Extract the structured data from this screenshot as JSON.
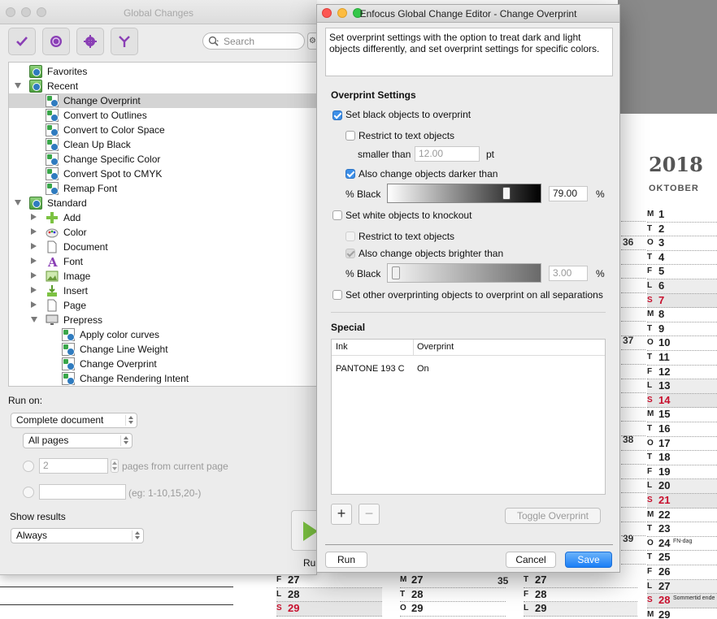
{
  "calendar": {
    "year": "2018",
    "month": "OKTOBER",
    "days": [
      {
        "d": "M",
        "n": "1"
      },
      {
        "d": "T",
        "n": "2"
      },
      {
        "d": "O",
        "n": "3"
      },
      {
        "d": "T",
        "n": "4"
      },
      {
        "d": "F",
        "n": "5"
      },
      {
        "d": "L",
        "n": "6"
      },
      {
        "d": "S",
        "n": "7"
      },
      {
        "d": "M",
        "n": "8"
      },
      {
        "d": "T",
        "n": "9"
      },
      {
        "d": "O",
        "n": "10"
      },
      {
        "d": "T",
        "n": "11"
      },
      {
        "d": "F",
        "n": "12"
      },
      {
        "d": "L",
        "n": "13"
      },
      {
        "d": "S",
        "n": "14"
      },
      {
        "d": "M",
        "n": "15"
      },
      {
        "d": "T",
        "n": "16"
      },
      {
        "d": "O",
        "n": "17"
      },
      {
        "d": "T",
        "n": "18"
      },
      {
        "d": "F",
        "n": "19"
      },
      {
        "d": "L",
        "n": "20"
      },
      {
        "d": "S",
        "n": "21"
      },
      {
        "d": "M",
        "n": "22"
      },
      {
        "d": "T",
        "n": "23"
      },
      {
        "d": "O",
        "n": "24",
        "note": "FN-dag"
      },
      {
        "d": "T",
        "n": "25"
      },
      {
        "d": "F",
        "n": "26"
      },
      {
        "d": "L",
        "n": "27"
      },
      {
        "d": "S",
        "n": "28",
        "note": "Sommertid ende"
      },
      {
        "d": "M",
        "n": "29"
      }
    ],
    "week_numbers": [
      "36",
      "37",
      "38",
      "39",
      "35"
    ],
    "bottom_cols": [
      [
        {
          "d": "F",
          "n": "27"
        },
        {
          "d": "L",
          "n": "28"
        },
        {
          "d": "S",
          "n": "29"
        }
      ],
      [
        {
          "d": "M",
          "n": "27"
        },
        {
          "d": "T",
          "n": "28"
        },
        {
          "d": "O",
          "n": "29"
        }
      ],
      [
        {
          "d": "T",
          "n": "27"
        },
        {
          "d": "F",
          "n": "28"
        },
        {
          "d": "L",
          "n": "29"
        }
      ]
    ]
  },
  "global_changes": {
    "title": "Global Changes",
    "search_placeholder": "Search",
    "tree": [
      {
        "label": "Favorites",
        "level": 0,
        "arrow": "none",
        "icon": "folder"
      },
      {
        "label": "Recent",
        "level": 0,
        "arrow": "down",
        "icon": "folder"
      },
      {
        "label": "Change Overprint",
        "level": 1,
        "arrow": "none",
        "icon": "doc",
        "selected": true
      },
      {
        "label": "Convert to Outlines",
        "level": 1,
        "arrow": "none",
        "icon": "doc"
      },
      {
        "label": "Convert to Color Space",
        "level": 1,
        "arrow": "none",
        "icon": "doc"
      },
      {
        "label": "Clean Up Black",
        "level": 1,
        "arrow": "none",
        "icon": "doc"
      },
      {
        "label": "Change Specific Color",
        "level": 1,
        "arrow": "none",
        "icon": "doc"
      },
      {
        "label": "Convert Spot to CMYK",
        "level": 1,
        "arrow": "none",
        "icon": "doc"
      },
      {
        "label": "Remap Font",
        "level": 1,
        "arrow": "none",
        "icon": "doc"
      },
      {
        "label": "Standard",
        "level": 0,
        "arrow": "down",
        "icon": "folder"
      },
      {
        "label": "Add",
        "level": 1,
        "arrow": "right",
        "icon": "plus"
      },
      {
        "label": "Color",
        "level": 1,
        "arrow": "right",
        "icon": "palette"
      },
      {
        "label": "Document",
        "level": 1,
        "arrow": "right",
        "icon": "page"
      },
      {
        "label": "Font",
        "level": 1,
        "arrow": "right",
        "icon": "font"
      },
      {
        "label": "Image",
        "level": 1,
        "arrow": "right",
        "icon": "image"
      },
      {
        "label": "Insert",
        "level": 1,
        "arrow": "right",
        "icon": "insert"
      },
      {
        "label": "Page",
        "level": 1,
        "arrow": "right",
        "icon": "page"
      },
      {
        "label": "Prepress",
        "level": 1,
        "arrow": "down",
        "icon": "monitor"
      },
      {
        "label": "Apply color curves",
        "level": 2,
        "arrow": "none",
        "icon": "doc"
      },
      {
        "label": "Change Line Weight",
        "level": 2,
        "arrow": "none",
        "icon": "doc"
      },
      {
        "label": "Change Overprint",
        "level": 2,
        "arrow": "none",
        "icon": "doc"
      },
      {
        "label": "Change Rendering Intent",
        "level": 2,
        "arrow": "none",
        "icon": "doc"
      }
    ],
    "run_on_label": "Run on:",
    "run_on_value": "Complete document",
    "pages_value": "All pages",
    "pages_count_value": "2",
    "pages_from_label": "pages from current page",
    "range_hint": "(eg: 1-10,15,20-)",
    "show_results_label": "Show results",
    "show_results_value": "Always",
    "run_label": "Run"
  },
  "dialog": {
    "title": "Enfocus Global Change Editor - Change Overprint",
    "description": "Set overprint settings with the option to treat dark and light objects differently, and set overprint settings for specific colors.",
    "overprint_heading": "Overprint Settings",
    "black_overprint": {
      "label": "Set black objects to overprint",
      "checked": true
    },
    "restrict_text_1": {
      "label": "Restrict to text objects",
      "checked": false
    },
    "smaller_than_label": "smaller than",
    "smaller_than_value": "12.00",
    "pt_unit": "pt",
    "darker_than": {
      "label": "Also change objects darker than",
      "checked": true
    },
    "pct_black_label": "% Black",
    "black_value": "79.00",
    "black_fraction": 0.79,
    "pct": "%",
    "white_knockout": {
      "label": "Set white objects to knockout",
      "checked": false
    },
    "restrict_text_2": {
      "label": "Restrict to text objects",
      "checked": false
    },
    "brighter_than": {
      "label": "Also change objects brighter than",
      "checked": true
    },
    "pct_black_label_2": "% Black",
    "white_value": "3.00",
    "white_fraction": 0.03,
    "other_overprint": {
      "label": "Set other overprinting objects to overprint on all separations",
      "checked": false
    },
    "special_heading": "Special",
    "table_headers": [
      "Ink",
      "Overprint"
    ],
    "table_rows": [
      {
        "ink": "PANTONE 193 C",
        "overprint": "On"
      }
    ],
    "add_symbol": "+",
    "remove_symbol": "−",
    "toggle_label": "Toggle Overprint",
    "run_label": "Run",
    "cancel_label": "Cancel",
    "save_label": "Save"
  },
  "colors": {
    "accent_blue": "#1a7ef6",
    "sunday_red": "#c8102e",
    "close_red": "#fc5753",
    "minimize_yellow": "#fdbc40",
    "zoom_green": "#33c748"
  }
}
